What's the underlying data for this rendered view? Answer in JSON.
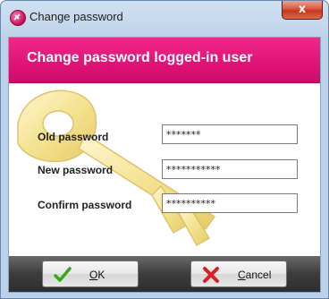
{
  "window": {
    "title": "Change password",
    "close_label": "x"
  },
  "banner": {
    "title": "Change password logged-in user"
  },
  "form": {
    "old_password": {
      "label": "Old password",
      "value": "*******"
    },
    "new_password": {
      "label": "New password",
      "value": "***********"
    },
    "confirm_password": {
      "label": "Confirm password",
      "value": "**********"
    }
  },
  "buttons": {
    "ok": {
      "accel": "O",
      "rest": "K",
      "icon": "check-icon"
    },
    "cancel": {
      "accel": "C",
      "rest": "ancel",
      "icon": "cross-icon"
    }
  },
  "icons": {
    "decoration": "key-icon",
    "app": "app-logo-icon"
  },
  "colors": {
    "banner": "#e01276",
    "footer": "#3e3e3e"
  }
}
